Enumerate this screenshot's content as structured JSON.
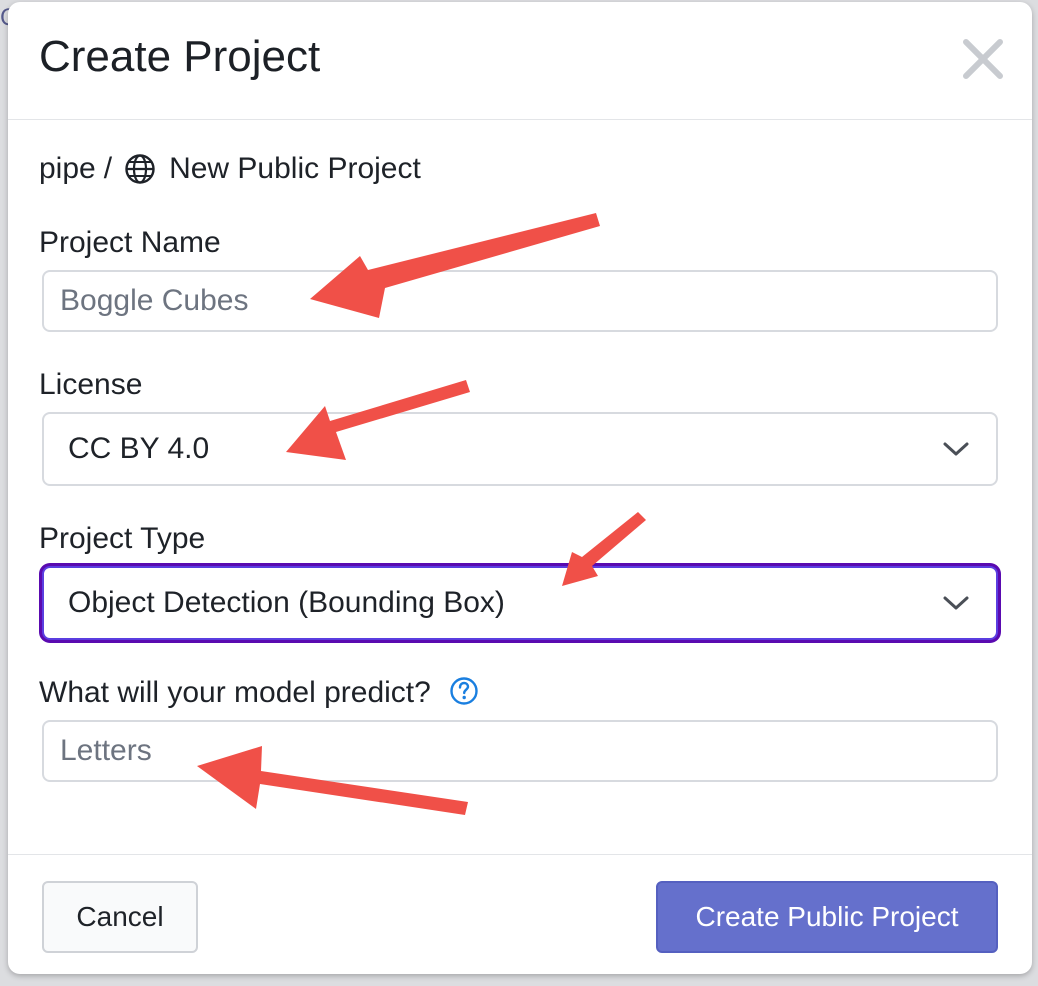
{
  "modal": {
    "title": "Create Project",
    "close_icon": "close-icon"
  },
  "breadcrumb": {
    "workspace": "pipe",
    "separator": "/",
    "visibility_icon": "globe-icon",
    "project": "New Public Project"
  },
  "form": {
    "project_name": {
      "label": "Project Name",
      "placeholder": "Boggle Cubes",
      "value": ""
    },
    "license": {
      "label": "License",
      "selected": "CC BY 4.0"
    },
    "project_type": {
      "label": "Project Type",
      "selected": "Object Detection (Bounding Box)"
    },
    "predict": {
      "label": "What will your model predict?",
      "help_icon": "question-circle-icon",
      "placeholder": "Letters",
      "value": ""
    }
  },
  "footer": {
    "cancel_label": "Cancel",
    "create_label": "Create Public Project"
  },
  "colors": {
    "accent": "#6570cc",
    "focus_ring": "#5a0ab0",
    "annotation_arrow": "#f05048",
    "help_icon": "#1a7fe0"
  }
}
